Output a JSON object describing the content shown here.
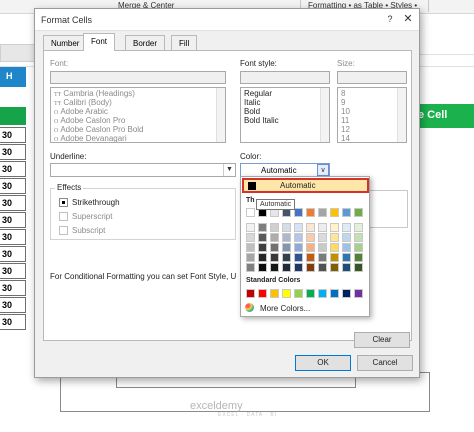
{
  "excel": {
    "ribbon": {
      "merge_label": "Merge & Center",
      "cond_format_label": "Formatting • as Table • Styles •"
    },
    "left_cell_letter": "H",
    "row_values": [
      "30",
      "30",
      "30",
      "30",
      "30",
      "30",
      "30",
      "30",
      "30",
      "30",
      "30",
      "30"
    ],
    "right_header": "e Cell",
    "watermark": "exceldemy",
    "watermark_sub": "EXCEL · DATA · BI"
  },
  "dialog": {
    "title": "Format Cells",
    "help": "?",
    "close": "✕",
    "tabs": [
      {
        "label": "Number",
        "active": false
      },
      {
        "label": "Font",
        "active": true
      },
      {
        "label": "Border",
        "active": false
      },
      {
        "label": "Fill",
        "active": false
      }
    ],
    "font_label": "Font:",
    "font_items": [
      {
        "label": "Cambria (Headings)",
        "tt": "TŦ"
      },
      {
        "label": "Calibri (Body)",
        "tt": "TŦ"
      },
      {
        "label": "Adobe Arabic",
        "tt": "O"
      },
      {
        "label": "Adobe Caslon Pro",
        "tt": "O"
      },
      {
        "label": "Adobe Caslon Pro Bold",
        "tt": "O"
      },
      {
        "label": "Adobe Devanagari",
        "tt": "O"
      }
    ],
    "style_label": "Font style:",
    "style_items": [
      "Regular",
      "Italic",
      "Bold",
      "Bold Italic"
    ],
    "size_label": "Size:",
    "size_items": [
      "8",
      "9",
      "10",
      "11",
      "12",
      "14"
    ],
    "underline_label": "Underline:",
    "underline_value": "",
    "color_label": "Color:",
    "color_value": "Automatic",
    "effects_label": "Effects",
    "effects": [
      {
        "label": "Strikethrough",
        "checked": true,
        "enabled": true
      },
      {
        "label": "Superscript",
        "checked": false,
        "enabled": false
      },
      {
        "label": "Subscript",
        "checked": false,
        "enabled": false
      }
    ],
    "info_text": "For Conditional Formatting you can set Font Style, U",
    "clear_label": "Clear",
    "ok_label": "OK",
    "cancel_label": "Cancel"
  },
  "color_picker": {
    "automatic_label": "Automatic",
    "tooltip": "Automatic",
    "theme_label": "Th",
    "theme_top_row": [
      "#ffffff",
      "#000000",
      "#e7e6e6",
      "#44546a",
      "#4472c4",
      "#ed7d31",
      "#a5a5a5",
      "#ffc000",
      "#5b9bd5",
      "#70ad47"
    ],
    "theme_shades": [
      [
        "#f2f2f2",
        "#7f7f7f",
        "#d0cece",
        "#d6dce4",
        "#d9e2f3",
        "#fbe5d5",
        "#ededed",
        "#fff2cc",
        "#deebf6",
        "#e2efd9"
      ],
      [
        "#d8d8d8",
        "#595959",
        "#aeabab",
        "#adb9ca",
        "#b4c6e7",
        "#f7cbac",
        "#dbdbdb",
        "#fee599",
        "#bdd7ee",
        "#c5e0b3"
      ],
      [
        "#bfbfbf",
        "#3f3f3f",
        "#757070",
        "#8496b0",
        "#8eaadb",
        "#f4b183",
        "#c9c9c9",
        "#ffd965",
        "#9cc3e5",
        "#a8d08d"
      ],
      [
        "#a5a5a5",
        "#262626",
        "#3a3838",
        "#323f4f",
        "#2f5496",
        "#c55a11",
        "#7b7b7b",
        "#bf9000",
        "#2e75b5",
        "#538135"
      ],
      [
        "#7f7f7f",
        "#0c0c0c",
        "#171616",
        "#222a35",
        "#1f3864",
        "#833c0b",
        "#525252",
        "#7f6000",
        "#1e4d78",
        "#375623"
      ]
    ],
    "standard_label": "Standard Colors",
    "standard": [
      "#c00000",
      "#ff0000",
      "#ffc000",
      "#ffff00",
      "#92d050",
      "#00b050",
      "#00b0f0",
      "#0070c0",
      "#002060",
      "#7030a0"
    ],
    "more_label": "More Colors..."
  }
}
